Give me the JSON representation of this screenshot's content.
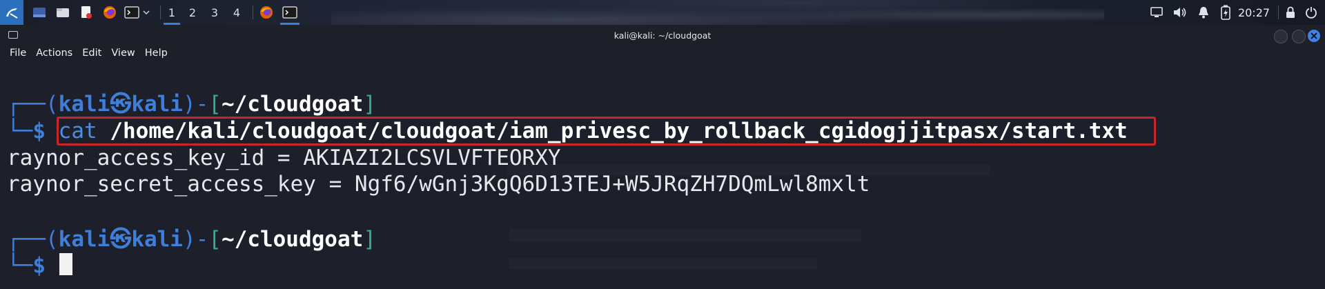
{
  "panel": {
    "workspaces": [
      "1",
      "2",
      "3",
      "4"
    ],
    "clock": "20:27"
  },
  "window": {
    "title": "kali@kali: ~/cloudgoat"
  },
  "menu": [
    "File",
    "Actions",
    "Edit",
    "View",
    "Help"
  ],
  "terminal": {
    "prompt1": {
      "user": "kali",
      "at_symbol": "㉿",
      "host": "kali",
      "path": "~/cloudgoat"
    },
    "command": {
      "program": "cat",
      "argument": "/home/kali/cloudgoat/cloudgoat/iam_privesc_by_rollback_cgidogjjitpasx/start.txt"
    },
    "output": [
      "raynor_access_key_id = AKIAZI2LCSVLVFTEORXY",
      "raynor_secret_access_key = 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"
    ],
    "prompt2": {
      "user": "kali",
      "at_symbol": "㉿",
      "host": "kali",
      "path": "~/cloudgoat"
    },
    "dollar": "$"
  },
  "colors": {
    "prompt_blue": "#3f7fd9",
    "bracket_green": "#33b08a",
    "highlight_red": "#c8262c",
    "terminal_bg": "#1d1f2a"
  }
}
